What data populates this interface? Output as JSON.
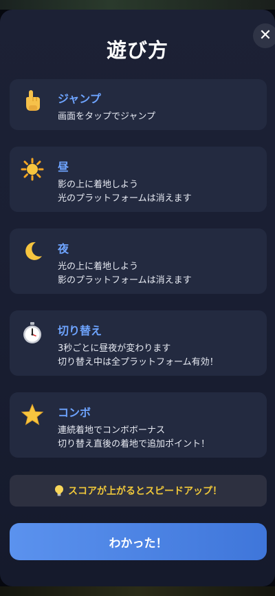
{
  "modal": {
    "title": "遊び方",
    "close_label": "✕"
  },
  "cards": [
    {
      "icon": "pointing-finger-icon",
      "title": "ジャンプ",
      "lines": [
        "画面をタップでジャンプ"
      ]
    },
    {
      "icon": "sun-icon",
      "title": "昼",
      "lines": [
        "影の上に着地しよう",
        "光のプラットフォームは消えます"
      ]
    },
    {
      "icon": "moon-icon",
      "title": "夜",
      "lines": [
        "光の上に着地しよう",
        "影のプラットフォームは消えます"
      ]
    },
    {
      "icon": "stopwatch-icon",
      "title": "切り替え",
      "lines": [
        "3秒ごとに昼夜が変わります",
        "切り替え中は全プラットフォーム有効！"
      ]
    },
    {
      "icon": "star-icon",
      "title": "コンボ",
      "lines": [
        "連続着地でコンボボーナス",
        "切り替え直後の着地で追加ポイント！"
      ]
    }
  ],
  "tip": {
    "icon": "lightbulb-icon",
    "text": "スコアが上がるとスピードアップ！"
  },
  "confirm_button": "わかった！",
  "colors": {
    "accent": "#6ea4ff",
    "tip_text": "#f0c83a",
    "button": "#4f86e6"
  }
}
